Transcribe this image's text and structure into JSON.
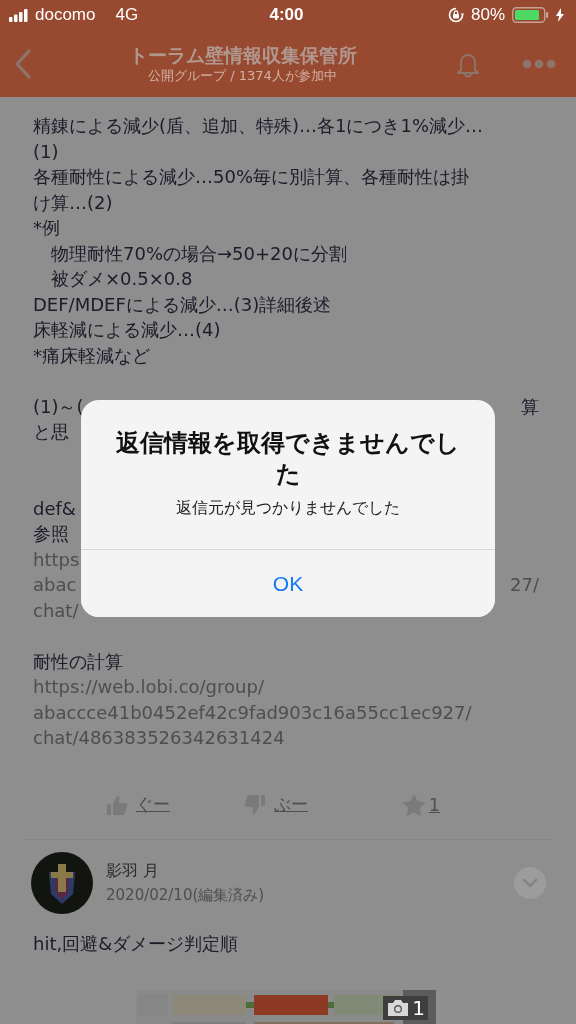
{
  "status_bar": {
    "carrier": "docomo",
    "network": "4G",
    "time": "4:00",
    "battery": "80%"
  },
  "header": {
    "title": "トーラム壁情報収集保管所",
    "subtitle": "公開グループ / 1374人が参加中"
  },
  "posts": [
    {
      "lines": [
        {
          "kind": "text",
          "text": "精錬による減少(盾、追加、特殊)…各1につき1%減少…"
        },
        {
          "kind": "text",
          "text": "(1)"
        },
        {
          "kind": "text",
          "text": "各種耐性による減少…50%毎に別計算、各種耐性は掛"
        },
        {
          "kind": "text",
          "text": "け算…(2)"
        },
        {
          "kind": "text",
          "text": "*例"
        },
        {
          "kind": "text",
          "text": "　物理耐性70%の場合→50+20に分割"
        },
        {
          "kind": "text",
          "text": "　被ダメ×0.5×0.8"
        },
        {
          "kind": "text",
          "text": "DEF/MDEFによる減少…(3)詳細後述"
        },
        {
          "kind": "text",
          "text": "床軽減による減少…(4)"
        },
        {
          "kind": "text",
          "text": "*痛床軽減など"
        },
        {
          "kind": "blank"
        },
        {
          "kind": "split",
          "left": "(1)～(",
          "right": "算"
        },
        {
          "kind": "text",
          "text": "と思"
        },
        {
          "kind": "blank"
        },
        {
          "kind": "blank"
        },
        {
          "kind": "text",
          "text": "def&"
        },
        {
          "kind": "text",
          "text": "参照"
        },
        {
          "kind": "link",
          "text": "https"
        },
        {
          "kind": "splitlink",
          "left": "abac",
          "right": "27/"
        },
        {
          "kind": "link",
          "text": "chat/"
        },
        {
          "kind": "blank"
        },
        {
          "kind": "text",
          "text": "耐性の計算"
        },
        {
          "kind": "link",
          "text": "https://web.lobi.co/group/"
        },
        {
          "kind": "link",
          "text": "abaccce41b0452ef42c9fad903c16a55cc1ec927/"
        },
        {
          "kind": "link",
          "text": "chat/486383526342631424"
        }
      ],
      "reactions": {
        "good": "ぐー",
        "bad": "ぶー",
        "stars": "1"
      }
    },
    {
      "author": "影羽 月",
      "date": "2020/02/10(編集済み)",
      "text": "hit,回避&ダメージ判定順",
      "image": {
        "kind": "picture",
        "count": "1"
      }
    }
  ],
  "dialog": {
    "title": "返信情報を取得できませんでした",
    "message": "返信元が見つかりませんでした",
    "button": "OK"
  }
}
